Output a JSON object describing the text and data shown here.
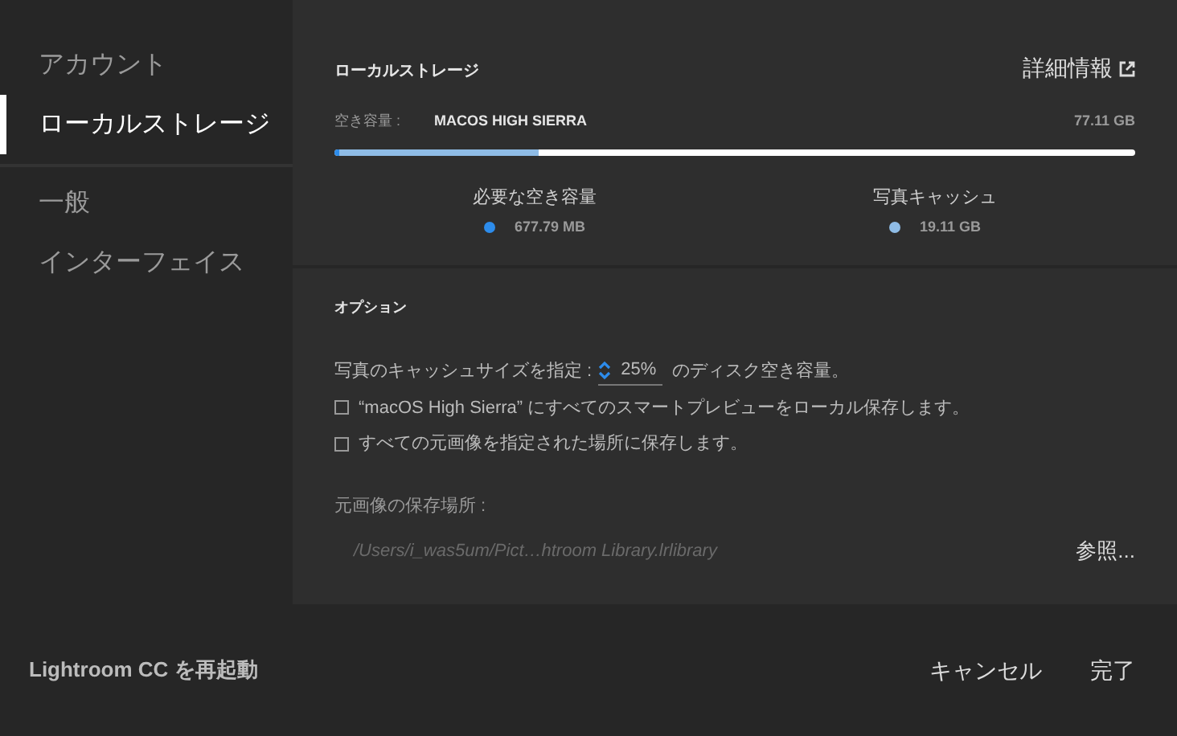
{
  "sidebar": {
    "items": [
      {
        "label": "アカウント",
        "selected": false
      },
      {
        "label": "ローカルストレージ",
        "selected": true
      },
      {
        "label": "一般",
        "selected": false
      },
      {
        "label": "インターフェイス",
        "selected": false
      }
    ]
  },
  "storage": {
    "title": "ローカルストレージ",
    "details_link": "詳細情報",
    "free_label": "空き容量 :",
    "volume": "MACOS HIGH SIERRA",
    "capacity": "77.11 GB",
    "usage_bar": [
      {
        "level": 0.006
      },
      {
        "level": 0.25
      }
    ],
    "segments": [
      {
        "label": "必要な空き容量",
        "value": "677.79 MB",
        "color": "#2d8ceb"
      },
      {
        "label": "写真キャッシュ",
        "value": "19.11 GB",
        "color": "#8fbce6"
      }
    ]
  },
  "options": {
    "title": "オプション",
    "cache_label": "写真のキャッシュサイズを指定 :",
    "cache_value": "25%",
    "cache_suffix": "のディスク空き容量。",
    "checkboxes": [
      {
        "label": "“macOS High Sierra” にすべてのスマートプレビューをローカル保存します。",
        "checked": false
      },
      {
        "label": "すべての元画像を指定された場所に保存します。",
        "checked": false
      }
    ],
    "location_label": "元画像の保存場所 :",
    "location_path": "/Users/i_was5um/Pict…htroom Library.lrlibrary",
    "browse": "参照..."
  },
  "footer": {
    "restart": "Lightroom CC を再起動",
    "cancel": "キャンセル",
    "done": "完了"
  }
}
